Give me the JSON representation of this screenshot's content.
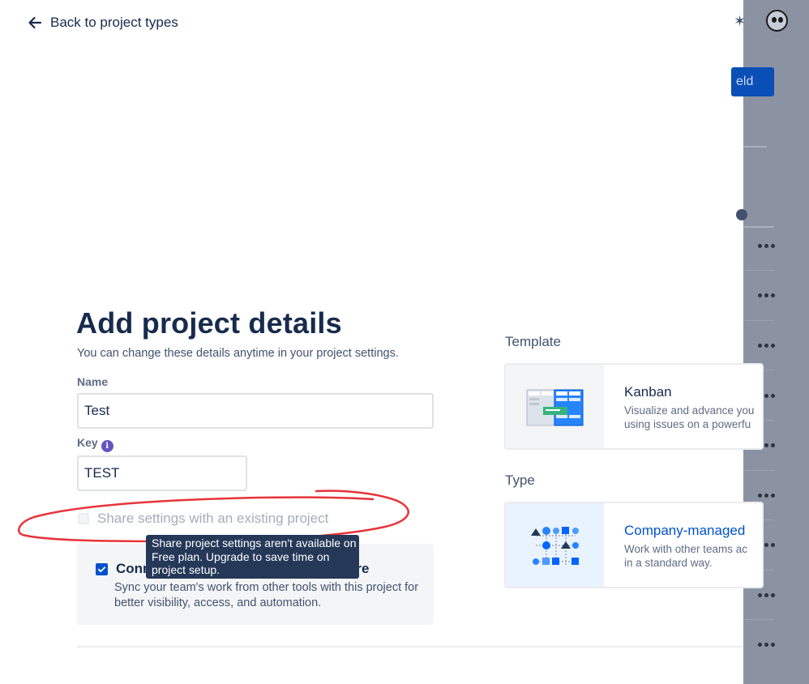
{
  "nav": {
    "back_label": "Back to project types"
  },
  "form": {
    "title": "Add project details",
    "subtitle": "You can change these details anytime in your project settings.",
    "name_label": "Name",
    "name_value": "Test",
    "key_label": "Key",
    "key_value": "TEST",
    "share_label": "Share settings with an existing project",
    "tooltip": "Share project settings aren't available on Free plan. Upgrade to save time on project setup.",
    "connect_title_start": "Conn",
    "connect_title_end": "ore",
    "connect_desc": "Sync your team's work from other tools with this project for better visibility, access, and automation."
  },
  "template": {
    "section_label": "Template",
    "name": "Kanban",
    "desc_line1": "Visualize and advance you",
    "desc_line2": "using issues on a powerfu"
  },
  "type": {
    "section_label": "Type",
    "name": "Company-managed",
    "desc_line1": "Work with other teams ac",
    "desc_line2": "in a standard way."
  },
  "background": {
    "button_partial": "eld"
  },
  "colors": {
    "text_dark": "#172B4D",
    "text_subtle": "#42526E",
    "brand_blue": "#0052CC",
    "overlay": "#8B93A3",
    "annotation_red": "#E8333A"
  }
}
